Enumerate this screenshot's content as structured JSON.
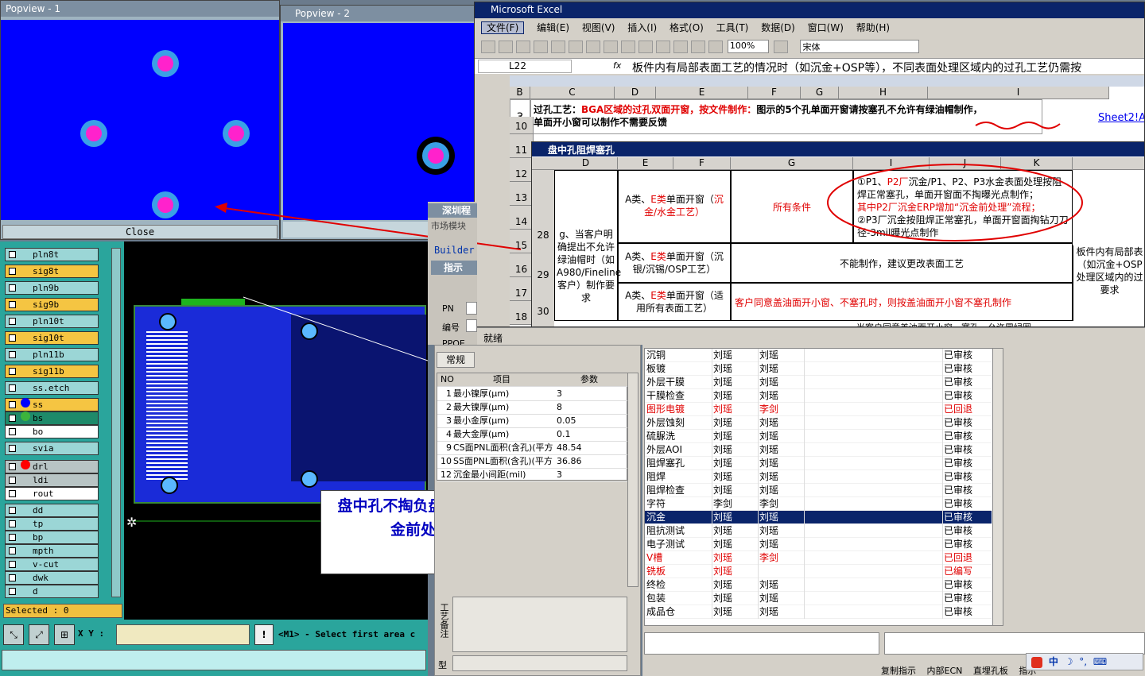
{
  "popview1": {
    "title": "Popview - 1",
    "close_label": "Close"
  },
  "popview2": {
    "title": "Popview - 2"
  },
  "excel": {
    "title": "Microsoft Excel",
    "menu": [
      "文件(F)",
      "编辑(E)",
      "视图(V)",
      "插入(I)",
      "格式(O)",
      "工具(T)",
      "数据(D)",
      "窗口(W)",
      "帮助(H)"
    ],
    "zoom": "100%",
    "font": "宋体",
    "name_box": "L22",
    "fx": "fx",
    "formula": "板件内有局部表面工艺的情况时（如沉金+OSP等），不同表面处理区域内的过孔工艺仍需按",
    "cols": [
      "B",
      "C",
      "D",
      "E",
      "F",
      "G",
      "H",
      "I"
    ],
    "row10": {
      "num": "10",
      "b": "3",
      "text1_label": "过孔工艺：",
      "text1_red": "BGA区域的过孔双面开窗，按文件制作：",
      "text1_rest": "图示的5个孔单面开窗请按塞孔不允许有绿油帽制作，",
      "text2": "单面开小窗可以制作不需要反馈",
      "link": "Sheet2!A"
    },
    "row_nums": [
      "11",
      "12",
      "13",
      "14",
      "15",
      "16",
      "17",
      "18"
    ]
  },
  "subsheet": {
    "title": "盘中孔阻焊塞孔",
    "cols": [
      "D",
      "E",
      "F",
      "G",
      "I",
      "J",
      "K"
    ],
    "row28": {
      "num": "28",
      "d": "g、当客户明确提出不允许绿油帽时（如A980/Fineline客户）制作要求",
      "e_prefix": "A类、",
      "e_red": "E类",
      "e_rest": "单面开窗（",
      "e_red2": "沉金/水金工艺）",
      "g": "所有条件",
      "i1": "①P1、",
      "i1r": "P2厂",
      "i1b": "沉金/P1、P2、P3水金表面处理按阻焊正常塞孔，单面开窗面不掏曝光点制作；",
      "i2r": "其中P2厂沉金ERP增加“沉金前处理”流程；",
      "i3": "②P3厂沉金按阻焊正常塞孔，单面开窗面掏钻刀刀径-3mil曝光点制作"
    },
    "row29": {
      "num": "29",
      "e_prefix": "A类、",
      "e_red": "E类",
      "e_rest": "单面开窗（沉银/沉锡/OSP工艺）",
      "g": "不能制作，建议更改表面工艺"
    },
    "row30": {
      "num": "30",
      "e_prefix": "A类、",
      "e_red": "E类",
      "e_rest": "单面开窗（适用所有表面工艺）",
      "g": "客户同意盖油面开小窗、不塞孔时，则按盖油面开小窗不塞孔制作"
    },
    "row31": {
      "g": "当客户同意盖油面开小窗、塞孔、允许冒绿圈"
    },
    "right_note": "板件内有局部表（如沉金+OSP处理区域内的过要求"
  },
  "status": {
    "ready": "就绪"
  },
  "cam": {
    "layers": [
      "pln8t",
      "sig8t",
      "pln9b",
      "sig9b",
      "pln10t",
      "sig10t",
      "pln11b",
      "sig11b",
      "ss.etch",
      "ss",
      "bs",
      "bo",
      "svia",
      "drl",
      "ldi",
      "rout",
      "dd",
      "tp",
      "bp",
      "mpth",
      "v-cut",
      "dwk",
      "d"
    ],
    "selected": "Selected : 0",
    "xy_label": "X Y :",
    "prompt": "<M1> - Select first area c",
    "annotation": "盘中孔不掏负盘，且需增加沉金前处理流程"
  },
  "mid": {
    "title1": "深圳程",
    "sub1": "市场模块",
    "builder": "Builder",
    "title2": "指示",
    "pn": "PN",
    "code": "编号",
    "ppqe": "PPQE",
    "tab": "常规",
    "head": [
      "NO",
      "项目",
      "参数"
    ],
    "rows": [
      [
        "1",
        "最小镍厚(μm)",
        "3"
      ],
      [
        "2",
        "最大镍厚(μm)",
        "8"
      ],
      [
        "3",
        "最小金厚(μm)",
        "0.05"
      ],
      [
        "4",
        "最大金厚(μm)",
        "0.1"
      ],
      [
        "9",
        "CS面PNL面积(含孔)(平方",
        "48.54"
      ],
      [
        "10",
        "SS面PNL面积(含孔)(平方",
        "36.86"
      ],
      [
        "12",
        "沉金最小间距(mil)",
        "3"
      ]
    ],
    "note1": "工艺备注",
    "note2": "型"
  },
  "process": {
    "rows": [
      [
        "沉铜",
        "刘瑶",
        "刘瑶",
        "已审核",
        "n"
      ],
      [
        "板镀",
        "刘瑶",
        "刘瑶",
        "已审核",
        "n"
      ],
      [
        "外层干膜",
        "刘瑶",
        "刘瑶",
        "已审核",
        "n"
      ],
      [
        "干膜检查",
        "刘瑶",
        "刘瑶",
        "已审核",
        "n"
      ],
      [
        "图形电镀",
        "刘瑶",
        "李剑",
        "已回退",
        "r"
      ],
      [
        "外层蚀刻",
        "刘瑶",
        "刘瑶",
        "已审核",
        "n"
      ],
      [
        "硫脲洗",
        "刘瑶",
        "刘瑶",
        "已审核",
        "n"
      ],
      [
        "外层AOI",
        "刘瑶",
        "刘瑶",
        "已审核",
        "n"
      ],
      [
        "阻焊塞孔",
        "刘瑶",
        "刘瑶",
        "已审核",
        "n"
      ],
      [
        "阻焊",
        "刘瑶",
        "刘瑶",
        "已审核",
        "n"
      ],
      [
        "阻焊检查",
        "刘瑶",
        "刘瑶",
        "已审核",
        "n"
      ],
      [
        "字符",
        "李剑",
        "李剑",
        "已审核",
        "n"
      ],
      [
        "沉金",
        "刘瑶",
        "刘瑶",
        "已审核",
        "s"
      ],
      [
        "阻抗测试",
        "刘瑶",
        "刘瑶",
        "已审核",
        "n"
      ],
      [
        "电子测试",
        "刘瑶",
        "刘瑶",
        "已审核",
        "n"
      ],
      [
        "V槽",
        "刘瑶",
        "李剑",
        "已回退",
        "r"
      ],
      [
        "铣板",
        "刘瑶",
        "",
        "已编写",
        "r"
      ],
      [
        "终检",
        "刘瑶",
        "刘瑶",
        "已审核",
        "n"
      ],
      [
        "包装",
        "刘瑶",
        "刘瑶",
        "已审核",
        "n"
      ],
      [
        "成品仓",
        "刘瑶",
        "刘瑶",
        "已审核",
        "n"
      ]
    ],
    "bottom_tabs": [
      "复制指示",
      "内部ECN",
      "直埋孔板",
      "指示"
    ]
  },
  "ime": {
    "label": "中"
  }
}
